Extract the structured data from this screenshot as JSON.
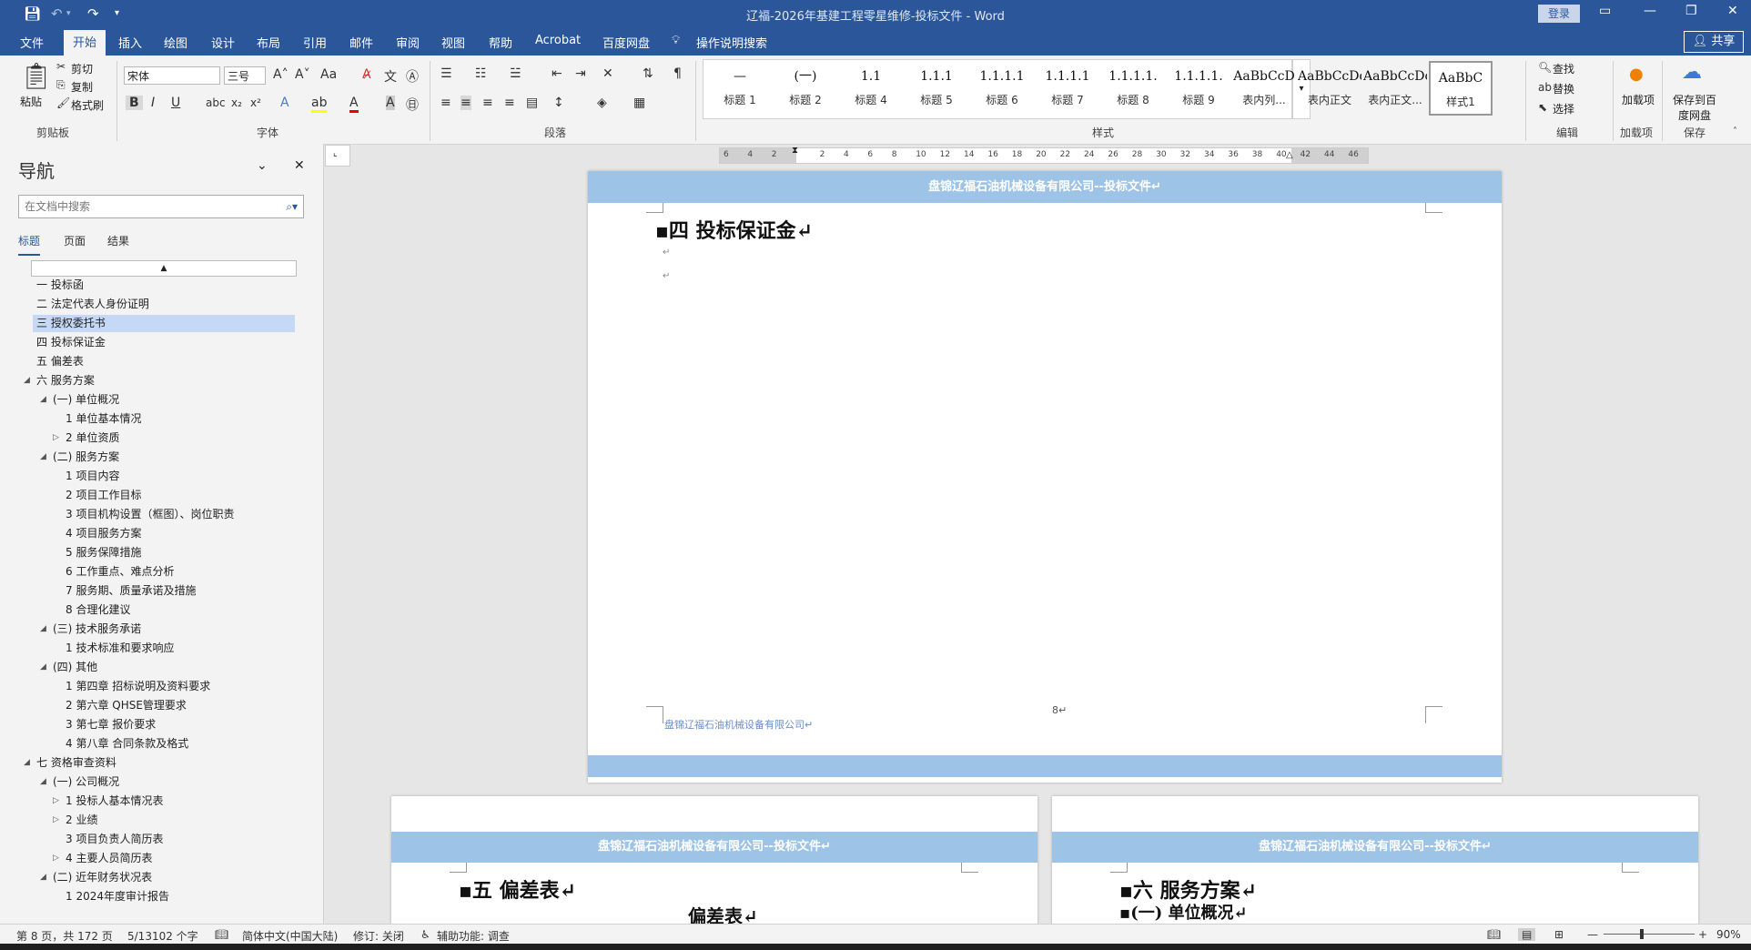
{
  "window": {
    "title": "辽福-2026年基建工程零星维修-投标文件 - Word",
    "login": "登录"
  },
  "tabs": [
    "文件",
    "开始",
    "插入",
    "绘图",
    "设计",
    "布局",
    "引用",
    "邮件",
    "审阅",
    "视图",
    "帮助",
    "Acrobat",
    "百度网盘"
  ],
  "active_tab": "开始",
  "tell_me": "操作说明搜索",
  "share": "共享",
  "ribbon": {
    "clipboard": {
      "paste": "粘贴",
      "cut": "剪切",
      "copy": "复制",
      "format_painter": "格式刷",
      "label": "剪贴板"
    },
    "font": {
      "name": "宋体",
      "size": "三号",
      "label": "字体"
    },
    "paragraph": {
      "label": "段落"
    },
    "styles": {
      "label": "样式",
      "items": [
        {
          "preview": "—",
          "name": "标题 1"
        },
        {
          "preview": "(一)",
          "name": "标题 2"
        },
        {
          "preview": "1.1",
          "name": "标题 4"
        },
        {
          "preview": "1.1.1",
          "name": "标题 5"
        },
        {
          "preview": "1.1.1.1",
          "name": "标题 6"
        },
        {
          "preview": "1.1.1.1",
          "name": "标题 7"
        },
        {
          "preview": "1.1.1.1.",
          "name": "标题 8"
        },
        {
          "preview": "1.1.1.1.",
          "name": "标题 9"
        },
        {
          "preview": "AaBbCcD",
          "name": "表内列..."
        },
        {
          "preview": "AaBbCcDdI",
          "name": "表内正文"
        },
        {
          "preview": "AaBbCcDc",
          "name": "表内正文..."
        },
        {
          "preview": "AaBbC",
          "name": "样式1"
        }
      ]
    },
    "editing": {
      "find": "查找",
      "replace": "替换",
      "select": "选择",
      "label": "编辑"
    },
    "addins": {
      "item": "加载项",
      "label": "加载项"
    },
    "save": {
      "item": "保存到百度网盘",
      "label": "保存"
    }
  },
  "nav": {
    "title": "导航",
    "search_placeholder": "在文档中搜索",
    "tabs": [
      "标题",
      "页面",
      "结果"
    ],
    "headings": [
      {
        "text": "一 投标函",
        "level": 1,
        "expander": "",
        "selected": false
      },
      {
        "text": "二 法定代表人身份证明",
        "level": 1,
        "expander": "",
        "selected": false
      },
      {
        "text": "三 授权委托书",
        "level": 1,
        "expander": "",
        "selected": true
      },
      {
        "text": "四 投标保证金",
        "level": 1,
        "expander": "",
        "selected": false
      },
      {
        "text": "五 偏差表",
        "level": 1,
        "expander": "",
        "selected": false
      },
      {
        "text": "六 服务方案",
        "level": 1,
        "expander": "expanded",
        "selected": false
      },
      {
        "text": "(一) 单位概况",
        "level": 2,
        "expander": "expanded",
        "selected": false
      },
      {
        "text": "1 单位基本情况",
        "level": 3,
        "expander": "",
        "selected": false
      },
      {
        "text": "2 单位资质",
        "level": 3,
        "expander": "collapsed",
        "selected": false
      },
      {
        "text": "(二) 服务方案",
        "level": 2,
        "expander": "expanded",
        "selected": false
      },
      {
        "text": "1 项目内容",
        "level": 3,
        "expander": "",
        "selected": false
      },
      {
        "text": "2 项目工作目标",
        "level": 3,
        "expander": "",
        "selected": false
      },
      {
        "text": "3 项目机构设置（框图）、岗位职责",
        "level": 3,
        "expander": "",
        "selected": false
      },
      {
        "text": "4 项目服务方案",
        "level": 3,
        "expander": "",
        "selected": false
      },
      {
        "text": "5 服务保障措施",
        "level": 3,
        "expander": "",
        "selected": false
      },
      {
        "text": "6 工作重点、难点分析",
        "level": 3,
        "expander": "",
        "selected": false
      },
      {
        "text": "7 服务期、质量承诺及措施",
        "level": 3,
        "expander": "",
        "selected": false
      },
      {
        "text": "8 合理化建议",
        "level": 3,
        "expander": "",
        "selected": false
      },
      {
        "text": "(三) 技术服务承诺",
        "level": 2,
        "expander": "expanded",
        "selected": false
      },
      {
        "text": "1 技术标准和要求响应",
        "level": 3,
        "expander": "",
        "selected": false
      },
      {
        "text": "(四) 其他",
        "level": 2,
        "expander": "expanded",
        "selected": false
      },
      {
        "text": "1 第四章  招标说明及资料要求",
        "level": 3,
        "expander": "",
        "selected": false
      },
      {
        "text": "2 第六章  QHSE管理要求",
        "level": 3,
        "expander": "",
        "selected": false
      },
      {
        "text": "3 第七章  报价要求",
        "level": 3,
        "expander": "",
        "selected": false
      },
      {
        "text": "4 第八章  合同条款及格式",
        "level": 3,
        "expander": "",
        "selected": false
      },
      {
        "text": "七 资格审查资料",
        "level": 1,
        "expander": "expanded",
        "selected": false
      },
      {
        "text": "(一) 公司概况",
        "level": 2,
        "expander": "expanded",
        "selected": false
      },
      {
        "text": "1 投标人基本情况表",
        "level": 3,
        "expander": "collapsed",
        "selected": false
      },
      {
        "text": "2 业绩",
        "level": 3,
        "expander": "collapsed",
        "selected": false
      },
      {
        "text": "3 项目负责人简历表",
        "level": 3,
        "expander": "",
        "selected": false
      },
      {
        "text": "4 主要人员简历表",
        "level": 3,
        "expander": "collapsed",
        "selected": false
      },
      {
        "text": "(二) 近年财务状况表",
        "level": 2,
        "expander": "expanded",
        "selected": false
      },
      {
        "text": "1 2024年度审计报告",
        "level": 3,
        "expander": "",
        "selected": false
      }
    ]
  },
  "ruler_ticks": [
    "6",
    "4",
    "2",
    "",
    "2",
    "4",
    "6",
    "8",
    "10",
    "12",
    "14",
    "16",
    "18",
    "20",
    "22",
    "24",
    "26",
    "28",
    "30",
    "32",
    "34",
    "36",
    "38",
    "40",
    "42",
    "44",
    "46"
  ],
  "document": {
    "page_main": {
      "header": "盘锦辽福石油机械设备有限公司--投标文件↵",
      "heading": "▪四 投标保证金↵",
      "empty_mark": "↵",
      "page_number": "8↵",
      "footer_text": "盘锦辽福石油机械设备有限公司↵"
    },
    "page_left": {
      "header": "盘锦辽福石油机械设备有限公司--投标文件↵",
      "heading": "▪五 偏差表↵",
      "subheading": "偏差表↵"
    },
    "page_right": {
      "header": "盘锦辽福石油机械设备有限公司--投标文件↵",
      "heading": "▪六 服务方案↵",
      "subheading": "▪(一) 单位概况↵"
    }
  },
  "status": {
    "page": "第 8 页，共 172 页",
    "words": "5/13102 个字",
    "language": "简体中文(中国大陆)",
    "track_changes": "修订: 关闭",
    "accessibility": "辅助功能: 调查",
    "zoom": "90%"
  },
  "colors": {
    "brand": "#2b579a",
    "header_band": "#9dc3e6",
    "selected_heading": "#c5d8f5"
  }
}
